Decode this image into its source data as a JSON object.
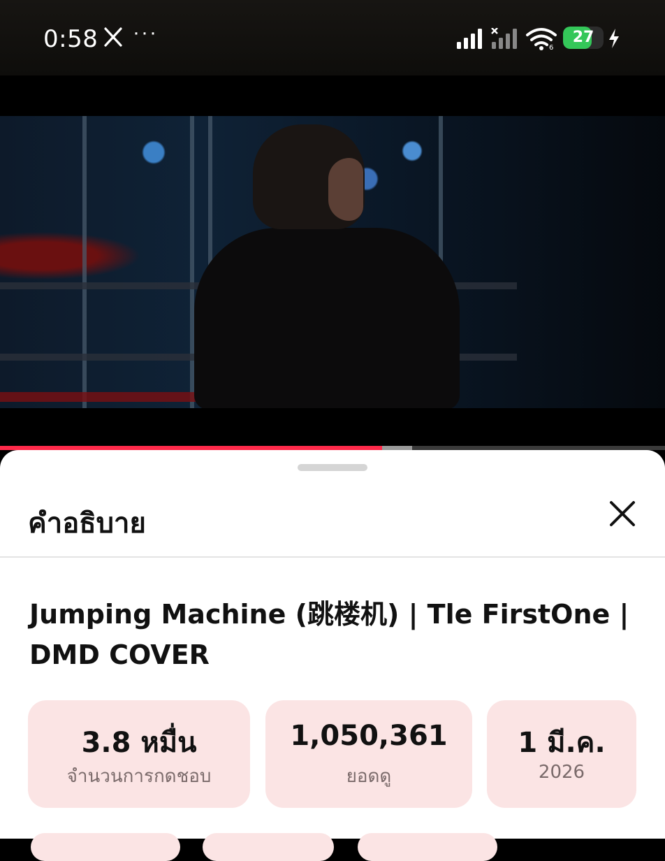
{
  "status_bar": {
    "time": "0:58",
    "more_dots": "···",
    "battery_level": 27,
    "battery_text": "27",
    "battery_color": "#34c759"
  },
  "player": {
    "progress_played_fraction": 0.575,
    "progress_buffered_fraction": 0.62,
    "progress_color": "#ff2a4a"
  },
  "description_sheet": {
    "title": "คำอธิบาย",
    "video_title": "Jumping Machine (跳楼机) | Tle FirstOne | DMD COVER",
    "stats": [
      {
        "value": "3.8 หมื่น",
        "label": "จำนวนการกดชอบ"
      },
      {
        "value": "1,050,361",
        "label": "ยอดดู"
      },
      {
        "value": "1 มี.ค.",
        "label": "2026"
      }
    ],
    "stat_bg_color": "#fbe4e4"
  }
}
